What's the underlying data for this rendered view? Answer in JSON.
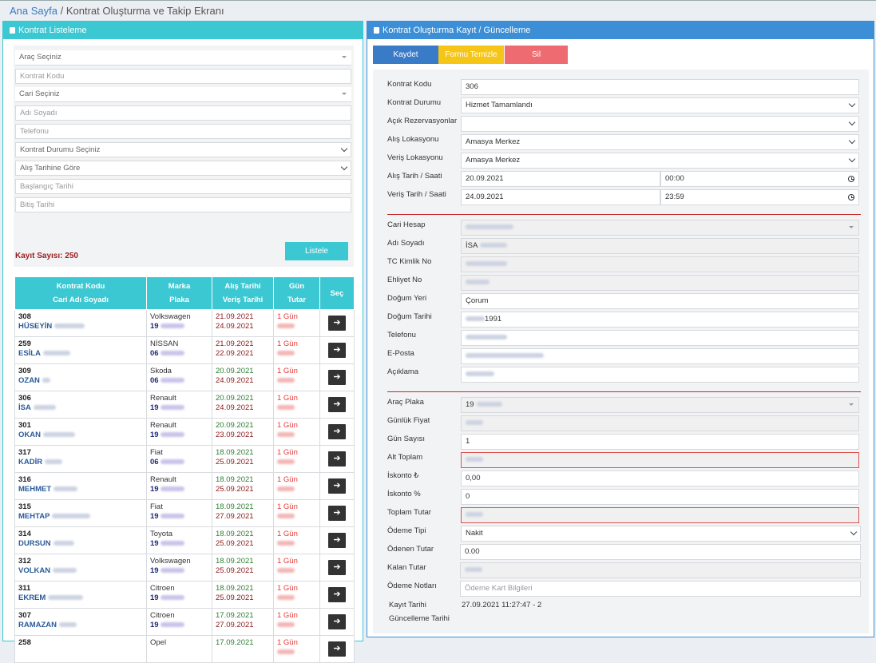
{
  "breadcrumb": {
    "home": "Ana Sayfa",
    "sep": " / ",
    "current": "Kontrat Oluşturma ve Takip Ekranı"
  },
  "left_panel": {
    "title": "Kontrat Listeleme",
    "filters": {
      "vehicle_select": "Araç Seçiniz",
      "contract_code_ph": "Kontrat Kodu",
      "account_select": "Cari Seçiniz",
      "name_ph": "Adı Soyadı",
      "phone_ph": "Telefonu",
      "status_select": "Kontrat Durumu Seçiniz",
      "date_mode_select": "Alış Tarihine Göre",
      "start_ph": "Başlangıç Tarihi",
      "end_ph": "Bitiş Tarihi"
    },
    "list_button": "Listele",
    "count_label": "Kayıt Sayısı: 250",
    "table": {
      "headers": {
        "code": "Kontrat Kodu",
        "name": "Cari Adı Soyadı",
        "brand": "Marka",
        "plate": "Plaka",
        "pick": "Alış Tarihi",
        "ret": "Veriş Tarihi",
        "day": "Gün",
        "total": "Tutar",
        "select": "Seç"
      },
      "rows": [
        {
          "code": "308",
          "name": "HÜSEYİN",
          "brand": "Volkswagen",
          "plate": "19",
          "pick": "21.09.2021",
          "ret": "24.09.2021",
          "day": "1 Gün",
          "pick_color": "red"
        },
        {
          "code": "259",
          "name": "ESİLA",
          "brand": "NİSSAN",
          "plate": "06",
          "pick": "21.09.2021",
          "ret": "22.09.2021",
          "day": "1 Gün",
          "pick_color": "red"
        },
        {
          "code": "309",
          "name": "OZAN",
          "brand": "Skoda",
          "plate": "06",
          "pick": "20.09.2021",
          "ret": "24.09.2021",
          "day": "1 Gün",
          "pick_color": "green"
        },
        {
          "code": "306",
          "name": "İSA",
          "brand": "Renault",
          "plate": "19",
          "pick": "20.09.2021",
          "ret": "24.09.2021",
          "day": "1 Gün",
          "pick_color": "green"
        },
        {
          "code": "301",
          "name": "OKAN",
          "brand": "Renault",
          "plate": "19",
          "pick": "20.09.2021",
          "ret": "23.09.2021",
          "day": "1 Gün",
          "pick_color": "green"
        },
        {
          "code": "317",
          "name": "KADİR",
          "brand": "Fiat",
          "plate": "06",
          "pick": "18.09.2021",
          "ret": "25.09.2021",
          "day": "1 Gün",
          "pick_color": "green"
        },
        {
          "code": "316",
          "name": "MEHMET",
          "brand": "Renault",
          "plate": "19",
          "pick": "18.09.2021",
          "ret": "25.09.2021",
          "day": "1 Gün",
          "pick_color": "green"
        },
        {
          "code": "315",
          "name": "MEHTAP",
          "brand": "Fiat",
          "plate": "19",
          "pick": "18.09.2021",
          "ret": "27.09.2021",
          "day": "1 Gün",
          "pick_color": "green"
        },
        {
          "code": "314",
          "name": "DURSUN",
          "brand": "Toyota",
          "plate": "19",
          "pick": "18.09.2021",
          "ret": "25.09.2021",
          "day": "1 Gün",
          "pick_color": "green"
        },
        {
          "code": "312",
          "name": "VOLKAN",
          "brand": "Volkswagen",
          "plate": "19",
          "pick": "18.09.2021",
          "ret": "25.09.2021",
          "day": "1 Gün",
          "pick_color": "green"
        },
        {
          "code": "311",
          "name": "EKREM",
          "brand": "Citroen",
          "plate": "19",
          "pick": "18.09.2021",
          "ret": "25.09.2021",
          "day": "1 Gün",
          "pick_color": "green"
        },
        {
          "code": "307",
          "name": "RAMAZAN",
          "brand": "Citroen",
          "plate": "19",
          "pick": "17.09.2021",
          "ret": "27.09.2021",
          "day": "1 Gün",
          "pick_color": "green"
        },
        {
          "code": "258",
          "name": "",
          "brand": "Opel",
          "plate": "",
          "pick": "17.09.2021",
          "ret": "",
          "day": "1 Gün",
          "pick_color": "green"
        }
      ]
    }
  },
  "right_panel": {
    "title": "Kontrat Oluşturma Kayıt / Güncelleme",
    "buttons": {
      "save": "Kaydet",
      "clear": "Formu Temizle",
      "delete": "Sil"
    },
    "colors": {
      "save": "#3a7bc8",
      "clear": "#f5c518",
      "delete": "#ef6b72"
    },
    "fields": {
      "contract_code": {
        "label": "Kontrat Kodu",
        "value": "306"
      },
      "contract_status": {
        "label": "Kontrat Durumu",
        "value": "Hizmet Tamamlandı"
      },
      "open_reservations": {
        "label": "Açık Rezervasyonlar",
        "value": ""
      },
      "pickup_location": {
        "label": "Alış Lokasyonu",
        "value": "Amasya Merkez"
      },
      "return_location": {
        "label": "Veriş Lokasyonu",
        "value": "Amasya Merkez"
      },
      "pickup_datetime": {
        "label": "Alış Tarih / Saati",
        "date": "20.09.2021",
        "time": "00:00"
      },
      "return_datetime": {
        "label": "Veriş Tarih / Saati",
        "date": "24.09.2021",
        "time": "23:59"
      },
      "account": {
        "label": "Cari Hesap",
        "value": ""
      },
      "full_name": {
        "label": "Adı Soyadı",
        "value": "İSA"
      },
      "tc_no": {
        "label": "TC Kimlik No",
        "value": ""
      },
      "license_no": {
        "label": "Ehliyet No",
        "value": ""
      },
      "birth_place": {
        "label": "Doğum Yeri",
        "value": "Çorum"
      },
      "birth_date": {
        "label": "Doğum Tarihi",
        "value": "1991"
      },
      "phone": {
        "label": "Telefonu",
        "value": ""
      },
      "email": {
        "label": "E-Posta",
        "value": ""
      },
      "note": {
        "label": "Açıklama",
        "value": ""
      },
      "vehicle_plate": {
        "label": "Araç Plaka",
        "value": "19"
      },
      "daily_price": {
        "label": "Günlük Fiyat",
        "value": ""
      },
      "day_count": {
        "label": "Gün Sayısı",
        "value": "1"
      },
      "subtotal": {
        "label": "Alt Toplam",
        "value": ""
      },
      "discount_amount": {
        "label": "İskonto ₺",
        "value": "0,00"
      },
      "discount_pct": {
        "label": "İskonto %",
        "value": "0"
      },
      "total": {
        "label": "Toplam Tutar",
        "value": ""
      },
      "payment_type": {
        "label": "Ödeme Tipi",
        "value": "Nakit"
      },
      "paid_amount": {
        "label": "Ödenen Tutar",
        "value": "0.00"
      },
      "remaining": {
        "label": "Kalan Tutar",
        "value": ""
      },
      "payment_notes": {
        "label": "Ödeme Notları",
        "placeholder": "Ödeme Kart Bilgileri"
      },
      "record_date": {
        "label": "Kayıt Tarihi",
        "value": "27.09.2021 11:27:47 - 2"
      },
      "update_date": {
        "label": "Güncelleme Tarihi",
        "value": ""
      }
    }
  }
}
